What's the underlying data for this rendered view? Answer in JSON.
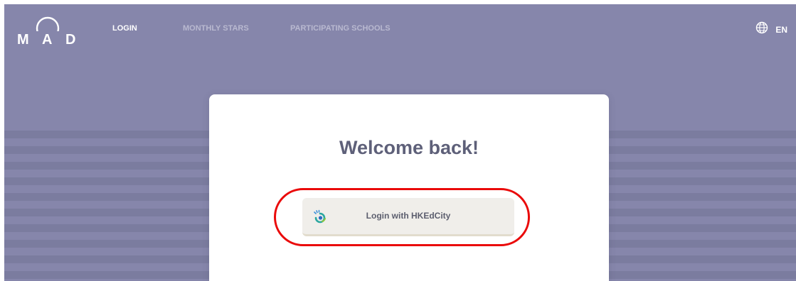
{
  "brand": {
    "logo_letters": [
      "M",
      "A",
      "D"
    ]
  },
  "nav": {
    "items": [
      {
        "label": "LOGIN",
        "active": true
      },
      {
        "label": "MONTHLY STARS",
        "active": false
      },
      {
        "label": "PARTICIPATING SCHOOLS",
        "active": false
      }
    ],
    "language": {
      "label": "EN",
      "icon": "globe-icon"
    }
  },
  "card": {
    "title": "Welcome back!",
    "login_button": {
      "label": "Login with HKEdCity",
      "icon": "hkedcity-logo-icon"
    }
  },
  "annotation": {
    "highlight_color": "#ea0a0a",
    "target": "login-with-hkedcity-button"
  },
  "colors": {
    "header_background": "#8686ab",
    "stripe": "#7b7c9f",
    "title_text": "#5e6079",
    "button_background": "#f0eeea"
  }
}
